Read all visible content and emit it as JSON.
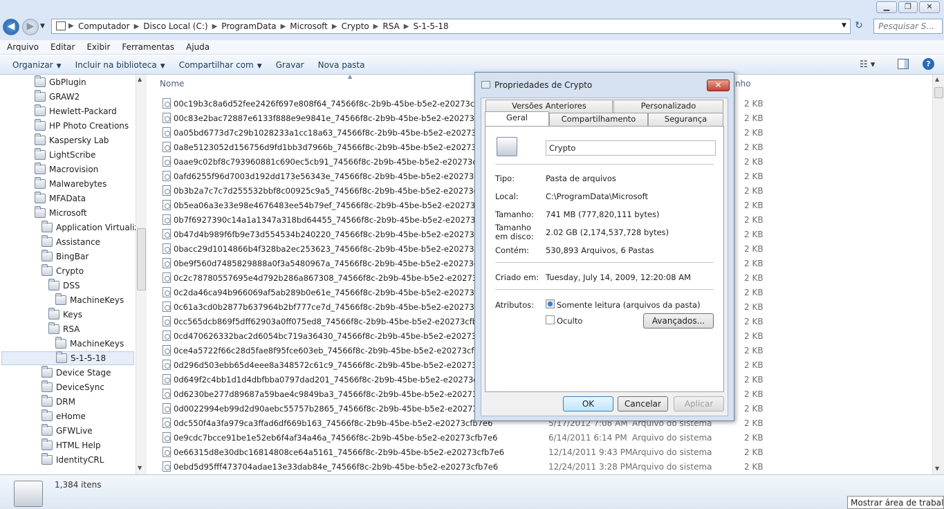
{
  "window": {
    "minimize": "▁",
    "maximize": "❐",
    "close": "✕"
  },
  "address": {
    "crumbs": [
      "Computador",
      "Disco Local (C:)",
      "ProgramData",
      "Microsoft",
      "Crypto",
      "RSA",
      "S-1-5-18"
    ],
    "search_placeholder": "Pesquisar S..."
  },
  "menu": [
    "Arquivo",
    "Editar",
    "Exibir",
    "Ferramentas",
    "Ajuda"
  ],
  "toolbar": {
    "organize": "Organizar",
    "include": "Incluir na biblioteca",
    "share": "Compartilhar com",
    "burn": "Gravar",
    "new_folder": "Nova pasta"
  },
  "tree": [
    {
      "label": "GbPlugin",
      "level": 0
    },
    {
      "label": "GRAW2",
      "level": 0
    },
    {
      "label": "Hewlett-Packard",
      "level": 0
    },
    {
      "label": "HP Photo Creations",
      "level": 0
    },
    {
      "label": "Kaspersky Lab",
      "level": 0
    },
    {
      "label": "LightScribe",
      "level": 0
    },
    {
      "label": "Macrovision",
      "level": 0
    },
    {
      "label": "Malwarebytes",
      "level": 0
    },
    {
      "label": "MFAData",
      "level": 0
    },
    {
      "label": "Microsoft",
      "level": 0
    },
    {
      "label": "Application Virtualiza",
      "level": 1
    },
    {
      "label": "Assistance",
      "level": 1
    },
    {
      "label": "BingBar",
      "level": 1
    },
    {
      "label": "Crypto",
      "level": 1
    },
    {
      "label": "DSS",
      "level": 2
    },
    {
      "label": "MachineKeys",
      "level": 3
    },
    {
      "label": "Keys",
      "level": 2
    },
    {
      "label": "RSA",
      "level": 2
    },
    {
      "label": "MachineKeys",
      "level": 3
    },
    {
      "label": "S-1-5-18",
      "level": 3,
      "selected": true
    },
    {
      "label": "Device Stage",
      "level": 1
    },
    {
      "label": "DeviceSync",
      "level": 1
    },
    {
      "label": "DRM",
      "level": 1
    },
    {
      "label": "eHome",
      "level": 1
    },
    {
      "label": "GFWLive",
      "level": 1
    },
    {
      "label": "HTML Help",
      "level": 1
    },
    {
      "label": "IdentityCRL",
      "level": 1
    }
  ],
  "list": {
    "col_name": "Nome",
    "col_size_partial": "nho",
    "files": [
      {
        "name": "00c19b3c8a6d52fee2426f697e808f64_74566f8c-2b9b-45be-b5e2-e20273cfb7e6",
        "date": "",
        "type": "",
        "size": "2 KB"
      },
      {
        "name": "00c83e2bac72887e6133f888e9e9841e_74566f8c-2b9b-45be-b5e2-e20273cfb7e6",
        "date": "",
        "type": "",
        "size": "2 KB"
      },
      {
        "name": "0a05bd6773d7c29b1028233a1cc18a63_74566f8c-2b9b-45be-b5e2-e20273cfb7e6",
        "date": "",
        "type": "",
        "size": "2 KB"
      },
      {
        "name": "0a8e5123052d156756d9fd1bb3d7966b_74566f8c-2b9b-45be-b5e2-e20273cfb7e6",
        "date": "",
        "type": "",
        "size": "2 KB"
      },
      {
        "name": "0aae9c02bf8c793960881c690ec5cb91_74566f8c-2b9b-45be-b5e2-e20273cfb7e6",
        "date": "",
        "type": "",
        "size": "2 KB"
      },
      {
        "name": "0afd6255f96d7003d192dd173e56343e_74566f8c-2b9b-45be-b5e2-e20273cfb7e6",
        "date": "",
        "type": "",
        "size": "2 KB"
      },
      {
        "name": "0b3b2a7c7c7d255532bbf8c00925c9a5_74566f8c-2b9b-45be-b5e2-e20273cfb7e6",
        "date": "",
        "type": "",
        "size": "2 KB"
      },
      {
        "name": "0b5ea06a3e33e98e4676483ee54b79ef_74566f8c-2b9b-45be-b5e2-e20273cfb7e6",
        "date": "",
        "type": "",
        "size": "2 KB"
      },
      {
        "name": "0b7f6927390c14a1a1347a318bd64455_74566f8c-2b9b-45be-b5e2-e20273cfb7e6",
        "date": "",
        "type": "",
        "size": "2 KB"
      },
      {
        "name": "0b47d4b989f6fb9e73d554534b240220_74566f8c-2b9b-45be-b5e2-e20273cfb7e6",
        "date": "",
        "type": "",
        "size": "2 KB"
      },
      {
        "name": "0bacc29d1014866b4f328ba2ec253623_74566f8c-2b9b-45be-b5e2-e20273cfb7e6",
        "date": "",
        "type": "",
        "size": "2 KB"
      },
      {
        "name": "0be9f560d7485829888a0f3a5480967a_74566f8c-2b9b-45be-b5e2-e20273cfb7e6",
        "date": "",
        "type": "",
        "size": "2 KB"
      },
      {
        "name": "0c2c78780557695e4d792b286a867308_74566f8c-2b9b-45be-b5e2-e20273cfb7e6",
        "date": "",
        "type": "",
        "size": "2 KB"
      },
      {
        "name": "0c2da46ca94b966069af5ab289b0e61e_74566f8c-2b9b-45be-b5e2-e20273cfb7e6",
        "date": "",
        "type": "",
        "size": "2 KB"
      },
      {
        "name": "0c61a3cd0b2877b637964b2bf777ce7d_74566f8c-2b9b-45be-b5e2-e20273cfb7e6",
        "date": "",
        "type": "",
        "size": "2 KB"
      },
      {
        "name": "0cc565dcb869f5dff62903a0ff075ed8_74566f8c-2b9b-45be-b5e2-e20273cfb7e6",
        "date": "",
        "type": "",
        "size": "2 KB"
      },
      {
        "name": "0cd470626332bac2d6054bc719a36430_74566f8c-2b9b-45be-b5e2-e20273cfb7e6",
        "date": "",
        "type": "",
        "size": "2 KB"
      },
      {
        "name": "0ce4a5722f66c28d5fae8f95fce603eb_74566f8c-2b9b-45be-b5e2-e20273cfb7e6",
        "date": "",
        "type": "",
        "size": "2 KB"
      },
      {
        "name": "0d296d503ebb65d4eee8a348572c61c9_74566f8c-2b9b-45be-b5e2-e20273cfb7e6",
        "date": "",
        "type": "",
        "size": "2 KB"
      },
      {
        "name": "0d649f2c4bb1d1d4dbfbba0797dad201_74566f8c-2b9b-45be-b5e2-e20273cfb7e6",
        "date": "",
        "type": "",
        "size": "2 KB"
      },
      {
        "name": "0d6230be277d89687a59bae4c9849ba3_74566f8c-2b9b-45be-b5e2-e20273cfb7e6",
        "date": "",
        "type": "",
        "size": "2 KB"
      },
      {
        "name": "0d0022994eb99d2d90aebc55757b2865_74566f8c-2b9b-45be-b5e2-e20273cfb7e6",
        "date": "",
        "type": "",
        "size": "2 KB"
      },
      {
        "name": "0dc550f4a3fa979ca3ffad6df669b163_74566f8c-2b9b-45be-b5e2-e20273cfb7e6",
        "date": "5/17/2012 7:08 AM",
        "type": "Arquivo do sistema",
        "size": "2 KB"
      },
      {
        "name": "0e9cdc7bcce91be1e52eb6f4af34a46a_74566f8c-2b9b-45be-b5e2-e20273cfb7e6",
        "date": "6/14/2011 6:14 PM",
        "type": "Arquivo do sistema",
        "size": "2 KB"
      },
      {
        "name": "0e66315d8e30dbc16814808ce64a5161_74566f8c-2b9b-45be-b5e2-e20273cfb7e6",
        "date": "12/14/2011 9:43 PM",
        "type": "Arquivo do sistema",
        "size": "2 KB"
      },
      {
        "name": "0ebd5d95fff473704adae13e33dab84e_74566f8c-2b9b-45be-b5e2-e20273cfb7e6",
        "date": "12/24/2011 3:28 PM",
        "type": "Arquivo do sistema",
        "size": "2 KB"
      }
    ]
  },
  "status": {
    "count": "1,384 itens",
    "show_desktop": "Mostrar área de trabalho"
  },
  "dialog": {
    "title": "Propriedades de Crypto",
    "tabs_row1": [
      "Versões Anteriores",
      "Personalizado"
    ],
    "tabs_row2": [
      "Geral",
      "Compartilhamento",
      "Segurança"
    ],
    "name": "Crypto",
    "props": [
      {
        "label": "Tipo:",
        "value": "Pasta de arquivos"
      },
      {
        "label": "Local:",
        "value": "C:\\ProgramData\\Microsoft"
      },
      {
        "label": "Tamanho:",
        "value": "741 MB (777,820,111 bytes)"
      },
      {
        "label": "Tamanho em disco:",
        "value": "2.02 GB (2,174,537,728 bytes)"
      },
      {
        "label": "Contém:",
        "value": "530,893 Arquivos, 6 Pastas"
      }
    ],
    "created_label": "Criado em:",
    "created_value": "Tuesday, July 14, 2009, 12:20:08 AM",
    "attrs_label": "Atributos:",
    "readonly_label": "Somente leitura (arquivos da pasta)",
    "hidden_label": "Oculto",
    "advanced": "Avançados...",
    "ok": "OK",
    "cancel": "Cancelar",
    "apply": "Aplicar"
  }
}
